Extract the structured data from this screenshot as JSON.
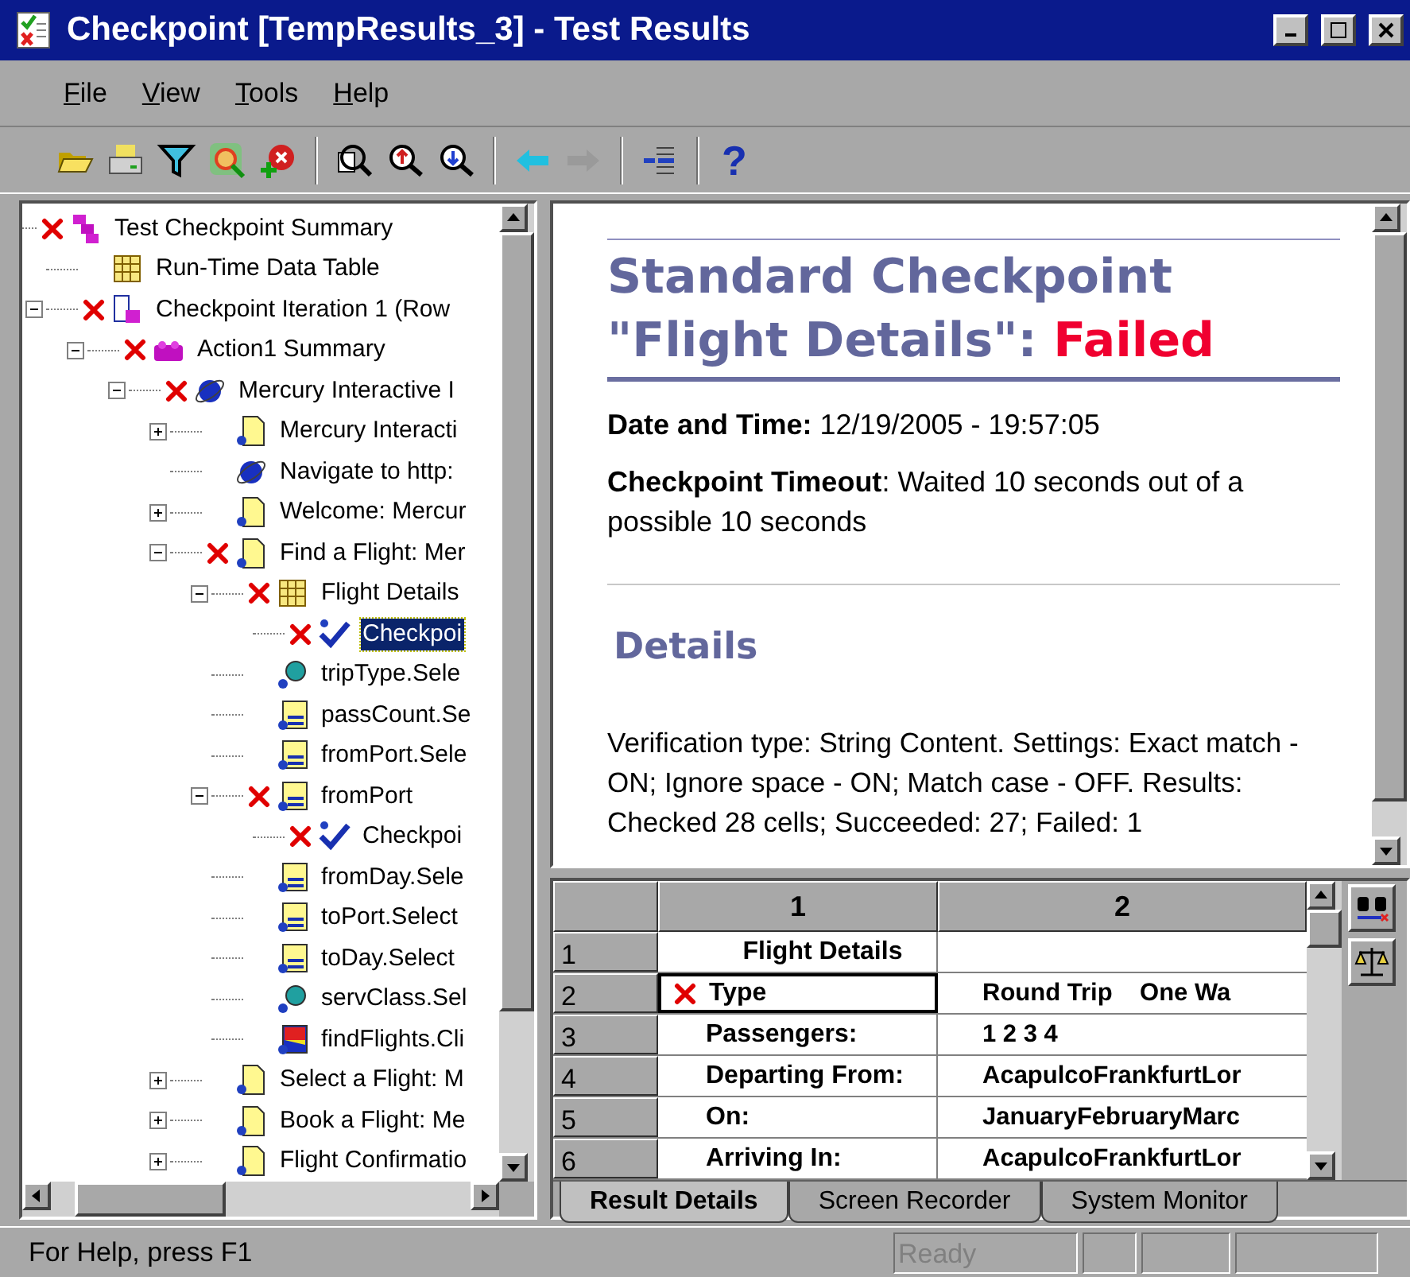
{
  "window": {
    "title": "Checkpoint [TempResults_3] - Test Results"
  },
  "menu": [
    "File",
    "View",
    "Tools",
    "Help"
  ],
  "toolbar": [
    {
      "kind": "open"
    },
    {
      "kind": "print"
    },
    {
      "kind": "filter"
    },
    {
      "kind": "radar"
    },
    {
      "kind": "addremove"
    },
    {
      "kind": "sep"
    },
    {
      "kind": "find"
    },
    {
      "kind": "zoomup"
    },
    {
      "kind": "zoomdown"
    },
    {
      "kind": "sep"
    },
    {
      "kind": "back",
      "disabled": false
    },
    {
      "kind": "forward",
      "disabled": true
    },
    {
      "kind": "sep"
    },
    {
      "kind": "indent"
    },
    {
      "kind": "sep"
    },
    {
      "kind": "help",
      "text": "?"
    }
  ],
  "tree": [
    {
      "label": "Test Checkpoint Summary",
      "kind": "summary",
      "failed": true,
      "selected": false,
      "children": [
        {
          "label": "Run-Time Data Table",
          "kind": "table",
          "failed": false,
          "selected": false
        },
        {
          "label": "Checkpoint Iteration 1 (Row",
          "kind": "iteration",
          "failed": true,
          "selected": false,
          "expanded": true,
          "children": [
            {
              "label": "Action1 Summary",
              "kind": "action",
              "failed": true,
              "selected": false,
              "expanded": true,
              "children": [
                {
                  "label": "Mercury Interactive I",
                  "kind": "web",
                  "failed": true,
                  "selected": false,
                  "expanded": true,
                  "children": [
                    {
                      "label": "Mercury Interacti",
                      "kind": "page",
                      "failed": false,
                      "selected": false,
                      "expanded": false
                    },
                    {
                      "label": "Navigate to http:",
                      "kind": "web",
                      "failed": false,
                      "selected": false
                    },
                    {
                      "label": "Welcome: Mercur",
                      "kind": "page",
                      "failed": false,
                      "selected": false,
                      "expanded": false
                    },
                    {
                      "label": "Find a Flight: Mer",
                      "kind": "page",
                      "failed": true,
                      "selected": false,
                      "expanded": true,
                      "children": [
                        {
                          "label": "Flight Details",
                          "kind": "table",
                          "failed": true,
                          "selected": false,
                          "expanded": true,
                          "children": [
                            {
                              "label": "Checkpoi",
                              "kind": "check",
                              "failed": true,
                              "selected": true
                            }
                          ]
                        },
                        {
                          "label": "tripType.Sele",
                          "kind": "radio",
                          "failed": false,
                          "selected": false
                        },
                        {
                          "label": "passCount.Se",
                          "kind": "list",
                          "failed": false,
                          "selected": false
                        },
                        {
                          "label": "fromPort.Sele",
                          "kind": "list",
                          "failed": false,
                          "selected": false
                        },
                        {
                          "label": "fromPort",
                          "kind": "list",
                          "failed": true,
                          "selected": false,
                          "expanded": true,
                          "children": [
                            {
                              "label": "Checkpoi",
                              "kind": "check",
                              "failed": true,
                              "selected": false
                            }
                          ]
                        },
                        {
                          "label": "fromDay.Sele",
                          "kind": "list",
                          "failed": false,
                          "selected": false
                        },
                        {
                          "label": "toPort.Select",
                          "kind": "list",
                          "failed": false,
                          "selected": false
                        },
                        {
                          "label": "toDay.Select",
                          "kind": "list",
                          "failed": false,
                          "selected": false
                        },
                        {
                          "label": "servClass.Sel",
                          "kind": "radio",
                          "failed": false,
                          "selected": false
                        },
                        {
                          "label": "findFlights.Cli",
                          "kind": "image",
                          "failed": false,
                          "selected": false
                        }
                      ]
                    },
                    {
                      "label": "Select a Flight: M",
                      "kind": "page",
                      "failed": false,
                      "selected": false,
                      "expanded": false
                    },
                    {
                      "label": "Book a Flight: Me",
                      "kind": "page",
                      "failed": false,
                      "selected": false,
                      "expanded": false
                    },
                    {
                      "label": "Flight Confirmatio",
                      "kind": "page",
                      "failed": false,
                      "selected": false,
                      "expanded": false
                    }
                  ]
                }
              ]
            }
          ]
        }
      ]
    }
  ],
  "report": {
    "title": "Standard Checkpoint \"Flight Details\":",
    "status": "Failed",
    "date": "**Date and Time:** 12/19/2005 - 19:57:05",
    "timeout": "**Checkpoint Timeout**: Waited 10 seconds out of a possible 10 seconds",
    "details_heading": "Details",
    "details": "Verification type: String Content. Settings: Exact match - ON; Ignore space - ON; Match case - OFF. Results: Checked 28 cells; Succeeded: 27; Failed: 1"
  },
  "grid": {
    "columns": [
      "1",
      "2"
    ],
    "rows": [
      {
        "header": "1",
        "kind": "heading",
        "label": "Flight Details",
        "failed": false,
        "selected": false
      },
      {
        "header": "2",
        "kind": "field",
        "label": "Type",
        "value": "Round Trip    One Wa",
        "failed": true,
        "selected": true
      },
      {
        "header": "3",
        "kind": "field",
        "label": "Passengers:",
        "value": "1 2 3 4",
        "failed": false,
        "selected": false
      },
      {
        "header": "4",
        "kind": "field",
        "label": "Departing From:",
        "value": "AcapulcoFrankfurtLor",
        "failed": false,
        "selected": false
      },
      {
        "header": "5",
        "kind": "field",
        "label": "On:",
        "value": "JanuaryFebruaryMarc",
        "failed": false,
        "selected": false
      },
      {
        "header": "6",
        "kind": "field",
        "label": "Arriving In:",
        "value": "AcapulcoFrankfurtLor",
        "failed": false,
        "selected": false
      }
    ]
  },
  "tabs": [
    {
      "label": "Result Details",
      "selected": true
    },
    {
      "label": "Screen Recorder",
      "selected": false
    },
    {
      "label": "System Monitor",
      "selected": false
    }
  ],
  "status_bar": {
    "help": "For Help, press F1",
    "state": "Ready"
  }
}
